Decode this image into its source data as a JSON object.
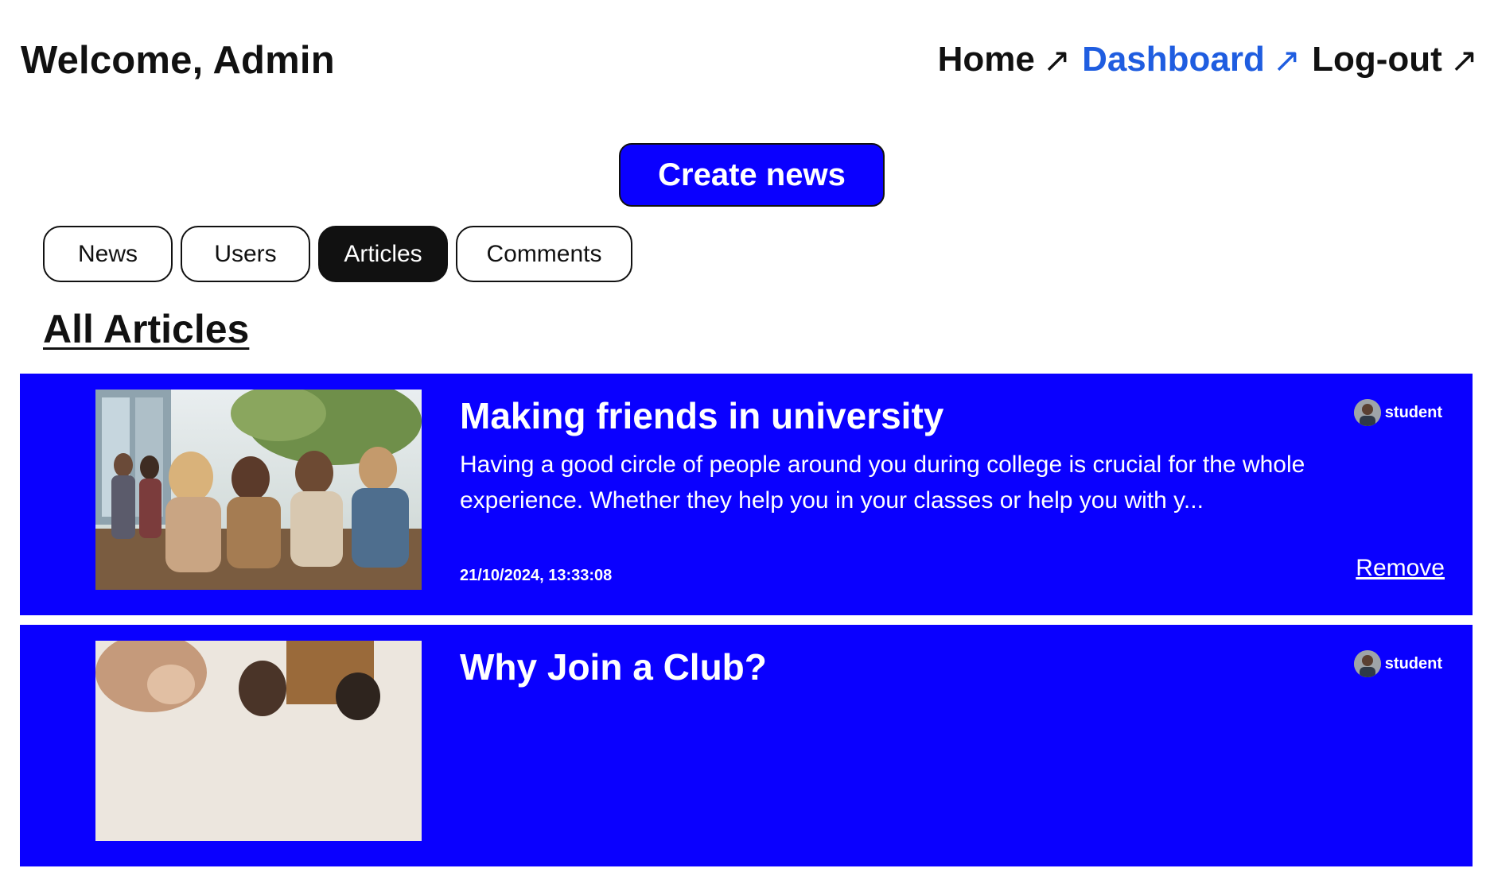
{
  "header": {
    "welcome": "Welcome, Admin",
    "nav": [
      {
        "label": "Home",
        "arrow": "↗",
        "active": false
      },
      {
        "label": "Dashboard",
        "arrow": "↗",
        "active": true
      },
      {
        "label": "Log-out",
        "arrow": "↗",
        "active": false
      }
    ]
  },
  "create_button": {
    "label": "Create news"
  },
  "tabs": [
    {
      "label": "News",
      "active": false
    },
    {
      "label": "Users",
      "active": false
    },
    {
      "label": "Articles",
      "active": true
    },
    {
      "label": "Comments",
      "active": false
    }
  ],
  "section": {
    "title": "All Articles"
  },
  "articles": [
    {
      "title": "Making friends in university",
      "excerpt": "Having a good circle of people around you during college is crucial for the whole experience. Whether they help you in your classes or help you with y...",
      "date": "21/10/2024, 13:33:08",
      "author": "student",
      "remove_label": "Remove",
      "image": "students-group-photo"
    },
    {
      "title": "Why Join a Club?",
      "excerpt": "",
      "date": "",
      "author": "student",
      "remove_label": "",
      "image": "club-photo"
    }
  ],
  "colors": {
    "accent": "#0a00ff",
    "active_link": "#1f5de0",
    "text": "#111111",
    "background": "#ffffff"
  }
}
